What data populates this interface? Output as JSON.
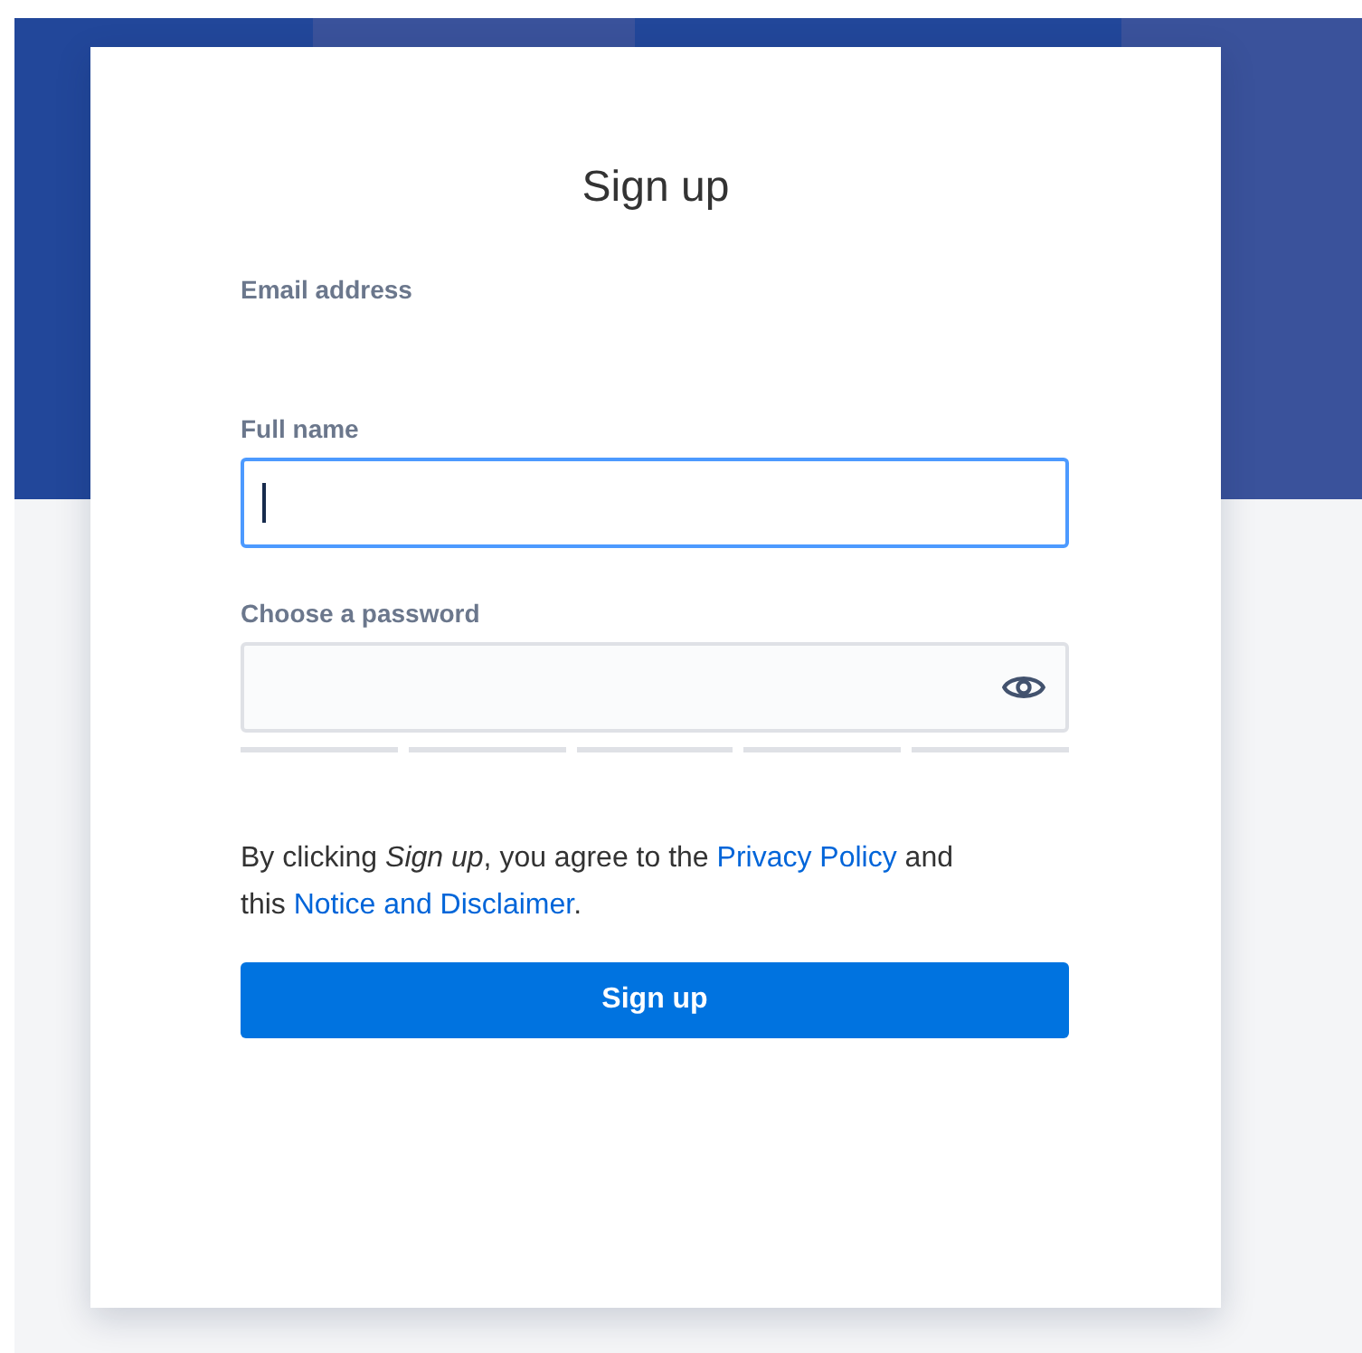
{
  "title": "Sign up",
  "email": {
    "label": "Email address"
  },
  "full_name": {
    "label": "Full name",
    "focused": true
  },
  "password": {
    "label": "Choose a password"
  },
  "agreement": {
    "before": "By clicking *Sign up*, you agree to the",
    "link1": "Privacy Policy",
    "middle": "and this",
    "link2": "Notice and Disclaimer",
    "after": "."
  },
  "button": "Sign up"
}
